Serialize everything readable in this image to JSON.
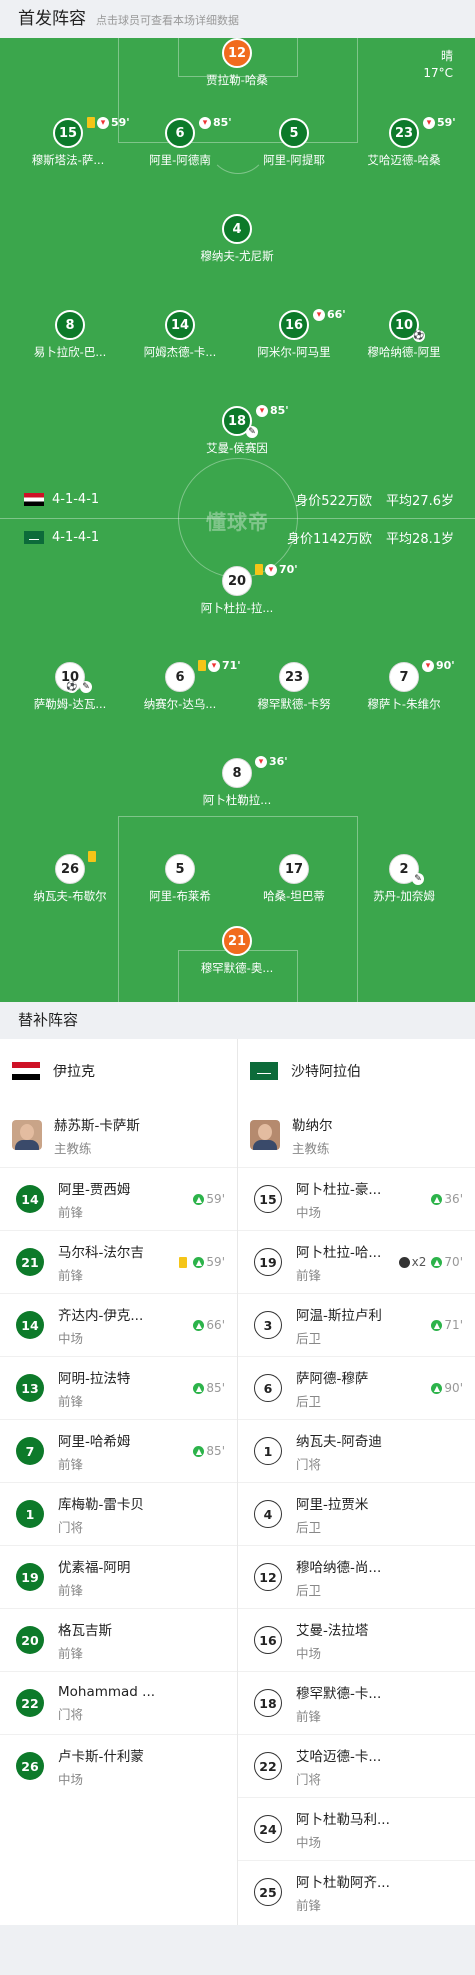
{
  "header": {
    "title": "首发阵容",
    "subtitle": "点击球员可查看本场详细数据"
  },
  "weather": {
    "condition": "晴",
    "temp": "17°C"
  },
  "watermark": "懂球帝",
  "home_info": {
    "formation": "4-1-4-1",
    "value": "身价522万欧",
    "age": "平均27.6岁"
  },
  "away_info": {
    "formation": "4-1-4-1",
    "value": "身价1142万欧",
    "age": "平均28.1岁"
  },
  "home_lineup": [
    {
      "num": "12",
      "name": "贾拉勒-哈桑",
      "gk": true
    },
    {
      "num": "15",
      "name": "穆斯塔法-萨...",
      "yellow": true,
      "subout": "59'"
    },
    {
      "num": "6",
      "name": "阿里-阿德南",
      "subout": "85'"
    },
    {
      "num": "5",
      "name": "阿里-阿提耶"
    },
    {
      "num": "23",
      "name": "艾哈迈德-哈桑",
      "subout": "59'"
    },
    {
      "num": "4",
      "name": "穆纳夫-尤尼斯"
    },
    {
      "num": "8",
      "name": "易卜拉欣-巴..."
    },
    {
      "num": "14",
      "name": "阿姆杰德-卡..."
    },
    {
      "num": "16",
      "name": "阿米尔-阿马里",
      "subout": "66'"
    },
    {
      "num": "10",
      "name": "穆哈纳德-阿里",
      "goal": true
    },
    {
      "num": "18",
      "name": "艾曼-侯赛因",
      "subout": "85'",
      "assist": true
    }
  ],
  "away_lineup": [
    {
      "num": "20",
      "name": "阿卜杜拉-拉...",
      "yellow": true,
      "subout": "70'"
    },
    {
      "num": "10",
      "name": "萨勒姆-达瓦...",
      "goal": true,
      "assist": true
    },
    {
      "num": "6",
      "name": "纳赛尔-达乌...",
      "yellow": true,
      "subout": "71'"
    },
    {
      "num": "23",
      "name": "穆罕默德-卡努"
    },
    {
      "num": "7",
      "name": "穆萨卜-朱维尔",
      "subout": "90'"
    },
    {
      "num": "8",
      "name": "阿卜杜勒拉...",
      "subout": "36'"
    },
    {
      "num": "26",
      "name": "纳瓦夫-布歇尔",
      "yellow": true
    },
    {
      "num": "5",
      "name": "阿里-布莱希"
    },
    {
      "num": "17",
      "name": "哈桑-坦巴蒂"
    },
    {
      "num": "2",
      "name": "苏丹-加奈姆",
      "assist": true
    },
    {
      "num": "21",
      "name": "穆罕默德-奥...",
      "gk": true
    }
  ],
  "subs": {
    "title": "替补阵容",
    "home": {
      "team": "伊拉克",
      "coach": {
        "name": "赫苏斯-卡萨斯",
        "role": "主教练"
      },
      "players": [
        {
          "num": "14",
          "name": "阿里-贾西姆",
          "pos": "前锋",
          "in": "59'"
        },
        {
          "num": "21",
          "name": "马尔科-法尔吉",
          "pos": "前锋",
          "in": "59'",
          "yellow": true
        },
        {
          "num": "14",
          "name": "齐达内-伊克...",
          "pos": "中场",
          "in": "66'"
        },
        {
          "num": "13",
          "name": "阿明-拉法特",
          "pos": "前锋",
          "in": "85'"
        },
        {
          "num": "7",
          "name": "阿里-哈希姆",
          "pos": "前锋",
          "in": "85'"
        },
        {
          "num": "1",
          "name": "库梅勒-雷卡贝",
          "pos": "门将"
        },
        {
          "num": "19",
          "name": "优素福-阿明",
          "pos": "前锋"
        },
        {
          "num": "20",
          "name": "格瓦吉斯",
          "pos": "前锋"
        },
        {
          "num": "22",
          "name": "Mohammad ...",
          "pos": "门将"
        },
        {
          "num": "26",
          "name": "卢卡斯-什利蒙",
          "pos": "中场"
        }
      ]
    },
    "away": {
      "team": "沙特阿拉伯",
      "coach": {
        "name": "勒纳尔",
        "role": "主教练"
      },
      "players": [
        {
          "num": "15",
          "name": "阿卜杜拉-豪...",
          "pos": "中场",
          "in": "36'"
        },
        {
          "num": "19",
          "name": "阿卜杜拉-哈...",
          "pos": "前锋",
          "in": "70'",
          "goals": "x2"
        },
        {
          "num": "3",
          "name": "阿温-斯拉卢利",
          "pos": "后卫",
          "in": "71'"
        },
        {
          "num": "6",
          "name": "萨阿德-穆萨",
          "pos": "后卫",
          "in": "90'"
        },
        {
          "num": "1",
          "name": "纳瓦夫-阿奇迪",
          "pos": "门将"
        },
        {
          "num": "4",
          "name": "阿里-拉贾米",
          "pos": "后卫"
        },
        {
          "num": "12",
          "name": "穆哈纳德-尚...",
          "pos": "后卫"
        },
        {
          "num": "16",
          "name": "艾曼-法拉塔",
          "pos": "中场"
        },
        {
          "num": "18",
          "name": "穆罕默德-卡...",
          "pos": "前锋"
        },
        {
          "num": "22",
          "name": "艾哈迈德-卡...",
          "pos": "门将"
        },
        {
          "num": "24",
          "name": "阿卜杜勒马利...",
          "pos": "中场"
        },
        {
          "num": "25",
          "name": "阿卜杜勒阿齐...",
          "pos": "前锋"
        }
      ]
    }
  }
}
